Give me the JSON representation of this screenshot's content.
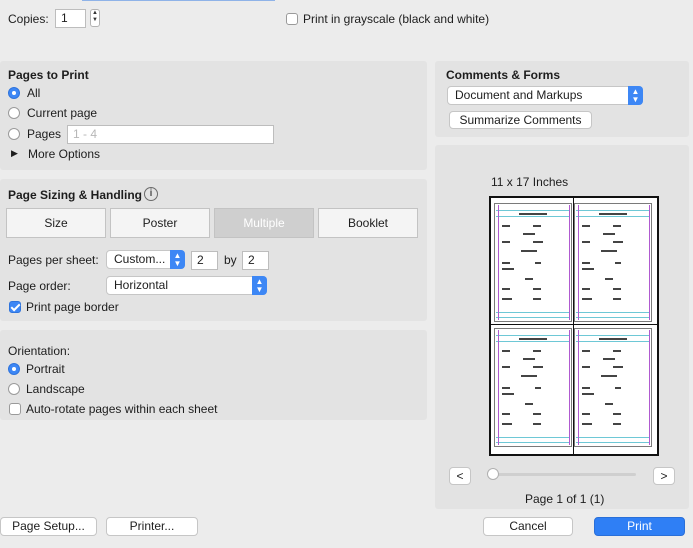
{
  "top": {
    "copies_label": "Copies:",
    "copies_value": "1",
    "grayscale_label": "Print in grayscale (black and white)",
    "grayscale_checked": false
  },
  "pages_to_print": {
    "title": "Pages to Print",
    "all_label": "All",
    "current_label": "Current page",
    "pages_label": "Pages",
    "pages_placeholder": "1 - 4",
    "more_options_label": "More Options",
    "selected": "All"
  },
  "sizing": {
    "title": "Page Sizing & Handling",
    "tabs": [
      "Size",
      "Poster",
      "Multiple",
      "Booklet"
    ],
    "selected_tab": "Multiple",
    "pages_per_sheet_label": "Pages per sheet:",
    "pages_per_sheet_value": "Custom...",
    "cols": "2",
    "by_label": "by",
    "rows": "2",
    "page_order_label": "Page order:",
    "page_order_value": "Horizontal",
    "border_label": "Print page border",
    "border_checked": true
  },
  "orientation": {
    "title": "Orientation:",
    "portrait_label": "Portrait",
    "landscape_label": "Landscape",
    "selected": "Portrait",
    "autorotate_label": "Auto-rotate pages within each sheet",
    "autorotate_checked": false
  },
  "comments": {
    "title": "Comments & Forms",
    "value": "Document and Markups",
    "summarize_label": "Summarize Comments"
  },
  "preview": {
    "paper_size": "11 x 17 Inches",
    "prev_label": "<",
    "next_label": ">",
    "page_status": "Page 1 of 1 (1)",
    "slider_position": 0
  },
  "footer": {
    "page_setup_label": "Page Setup...",
    "printer_label": "Printer...",
    "cancel_label": "Cancel",
    "print_label": "Print"
  },
  "colors": {
    "accent": "#3d87f5",
    "panel": "#e3e3e3",
    "background": "#ececec"
  }
}
